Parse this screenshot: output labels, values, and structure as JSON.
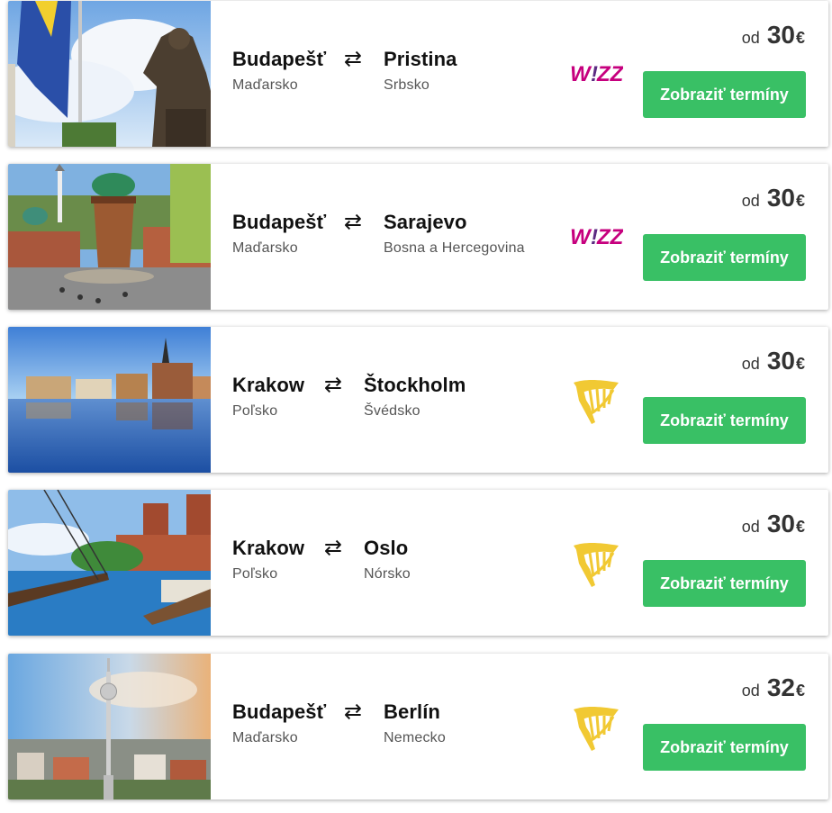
{
  "flights": [
    {
      "from_city": "Budapešť",
      "from_country": "Maďarsko",
      "to_city": "Pristina",
      "to_country": "Srbsko",
      "airline": "wizz-air-logo",
      "price_prefix": "od",
      "price": "30",
      "currency": "€",
      "button_label": "Zobraziť termíny",
      "image": "pristina-statue-photo"
    },
    {
      "from_city": "Budapešť",
      "from_country": "Maďarsko",
      "to_city": "Sarajevo",
      "to_country": "Bosna a Hercegovina",
      "airline": "wizz-air-logo",
      "price_prefix": "od",
      "price": "30",
      "currency": "€",
      "button_label": "Zobraziť termíny",
      "image": "sarajevo-sebilj-photo"
    },
    {
      "from_city": "Krakow",
      "from_country": "Poľsko",
      "to_city": "Štockholm",
      "to_country": "Švédsko",
      "airline": "ryanair-harp-logo",
      "price_prefix": "od",
      "price": "30",
      "currency": "€",
      "button_label": "Zobraziť termíny",
      "image": "stockholm-waterfront-photo"
    },
    {
      "from_city": "Krakow",
      "from_country": "Poľsko",
      "to_city": "Oslo",
      "to_country": "Nórsko",
      "airline": "ryanair-harp-logo",
      "price_prefix": "od",
      "price": "30",
      "currency": "€",
      "button_label": "Zobraziť termíny",
      "image": "oslo-city-hall-harbour-photo"
    },
    {
      "from_city": "Budapešť",
      "from_country": "Maďarsko",
      "to_city": "Berlín",
      "to_country": "Nemecko",
      "airline": "ryanair-harp-logo",
      "price_prefix": "od",
      "price": "32",
      "currency": "€",
      "button_label": "Zobraziť termíny",
      "image": "berlin-tv-tower-photo"
    }
  ],
  "colors": {
    "button_green": "#39c065",
    "wizz_magenta": "#c6007e",
    "wizz_purple": "#5b2b82",
    "ryanair_yellow": "#f1c933"
  },
  "icons": {
    "route_arrow": "⇄"
  }
}
